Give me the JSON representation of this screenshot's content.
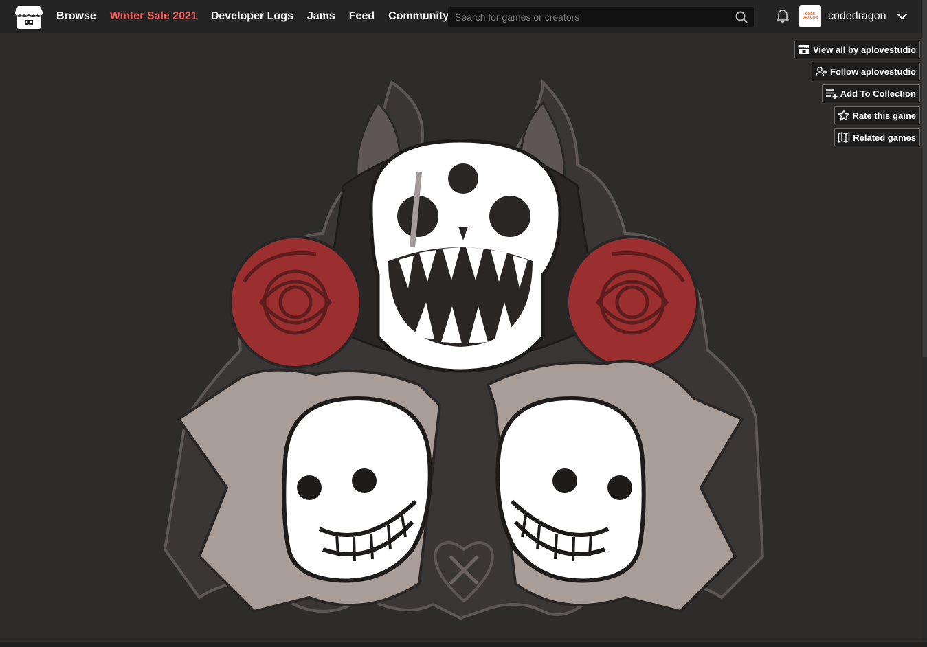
{
  "header": {
    "nav": [
      {
        "label": "Browse"
      },
      {
        "label": "Winter Sale 2021"
      },
      {
        "label": "Developer Logs"
      },
      {
        "label": "Jams"
      },
      {
        "label": "Feed"
      },
      {
        "label": "Community"
      }
    ],
    "search": {
      "placeholder": "Search for games or creators"
    },
    "user": {
      "name": "codedragon",
      "avatar_text_1": "CODE",
      "avatar_text_2": "DRAGON"
    }
  },
  "tools": [
    {
      "label": "View all by aplovestudio",
      "icon": "itchio-icon"
    },
    {
      "label": "Follow aplovestudio",
      "icon": "follow-user-icon"
    },
    {
      "label": "Add To Collection",
      "icon": "add-to-list-icon"
    },
    {
      "label": "Rate this game",
      "icon": "star-icon"
    },
    {
      "label": "Related games",
      "icon": "map-icon"
    }
  ],
  "colors": {
    "background": "#2e2b2b",
    "header": "#242424",
    "sale": "#fa5c5c",
    "rose": "#9b2f2f",
    "skull": "#ffffff",
    "horn": "#5e5656",
    "cloak": "#a89d97"
  }
}
